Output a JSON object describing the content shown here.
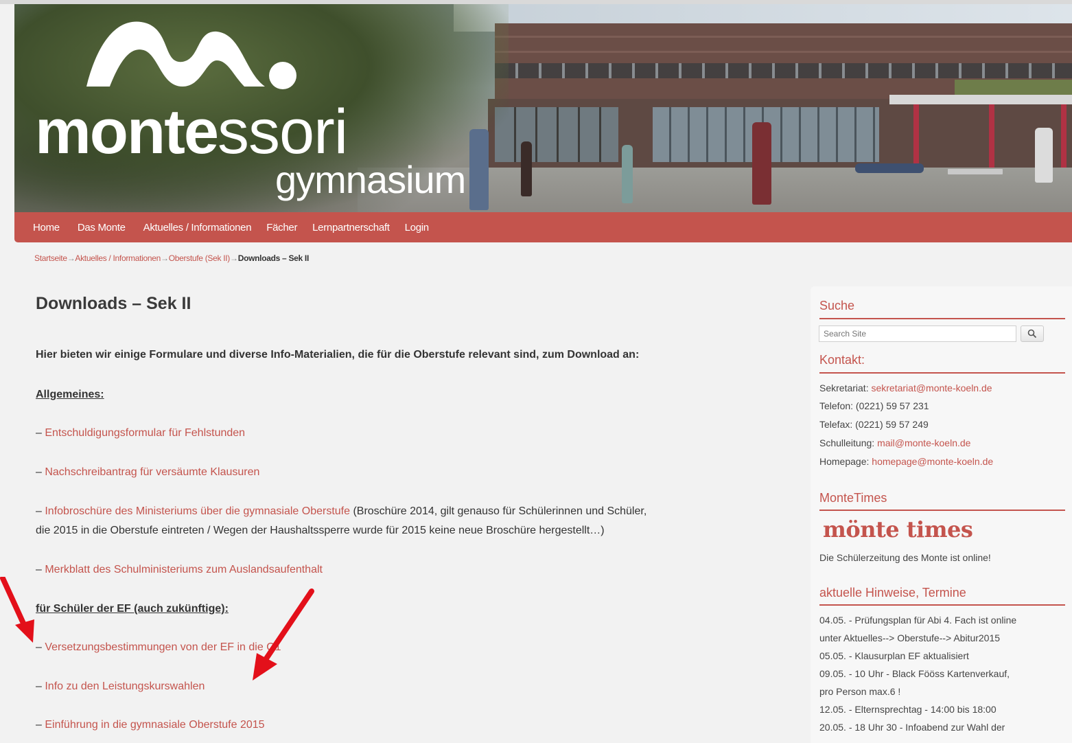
{
  "header": {
    "logo_text_bold": "monte",
    "logo_text_light": "ssori",
    "logo_subtitle": "gymnasium"
  },
  "nav": {
    "items": [
      "Home",
      "Das Monte",
      "Aktuelles / Informationen",
      "Fächer",
      "Lernpartnerschaft",
      "Login"
    ]
  },
  "breadcrumb": {
    "items": [
      "Startseite",
      "Aktuelles / Informationen",
      "Oberstufe (Sek II)"
    ],
    "separator": "→",
    "current": "Downloads – Sek II"
  },
  "main": {
    "title": "Downloads – Sek II",
    "intro": "Hier bieten wir einige Formulare und diverse Info-Materialien, die für die Oberstufe relevant sind, zum Download an:",
    "section_general": "Allgemeines:",
    "dash": "– ",
    "link_excuse": "Entschuldigungsformular für Fehlstunden",
    "link_makeup": "Nachschreibantrag für versäumte Klausuren",
    "link_brochure": "Infobroschüre des Ministeriums über die gymnasiale Oberstufe",
    "brochure_note_line1": " (Broschüre 2014, gilt genauso für Schülerinnen und Schüler,",
    "brochure_note_line2": "die 2015 in die Oberstufe eintreten / Wegen der Haushaltssperre wurde für 2015 keine neue Broschüre hergestellt…)",
    "link_abroad": "Merkblatt des Schulministeriums zum Auslandsaufenthalt",
    "section_ef": "für Schüler der EF (auch zukünftige):",
    "link_promotion": "Versetzungsbestimmungen von der EF in die Q1",
    "link_lk": "Info zu den Leistungskurswahlen",
    "link_intro": "Einführung in die gymnasiale Oberstufe 2015"
  },
  "sidebar": {
    "search_title": "Suche",
    "search_placeholder": "Search Site",
    "contact_title": "Kontakt:",
    "contact": {
      "secretariat_label": "Sekretariat: ",
      "secretariat_email": "sekretariat@monte-koeln.de",
      "phone": "Telefon: (0221) 59 57 231",
      "fax": "Telefax: (0221) 59 57 249",
      "principal_label": "Schulleitung: ",
      "principal_email": "mail@monte-koeln.de",
      "homepage_label": "Homepage: ",
      "homepage_email": "homepage@monte-koeln.de"
    },
    "times_title": "MonteTimes",
    "times_logo": "mönte times",
    "times_text": "Die Schülerzeitung des Monte ist online!",
    "notes_title": "aktuelle Hinweise, Termine",
    "notes": [
      "04.05. - Prüfungsplan für Abi 4. Fach ist online",
      "unter Aktuelles--> Oberstufe--> Abitur2015",
      "05.05. - Klausurplan EF aktualisiert",
      "09.05. - 10 Uhr - Black Fööss Kartenverkauf,",
      "pro Person max.6 !",
      "12.05. - Elternsprechtag - 14:00 bis 18:00",
      "20.05. - 18 Uhr 30 - Infoabend zur Wahl der"
    ]
  },
  "colors": {
    "accent": "#c4544d",
    "annotation_arrow": "#e3101a"
  }
}
